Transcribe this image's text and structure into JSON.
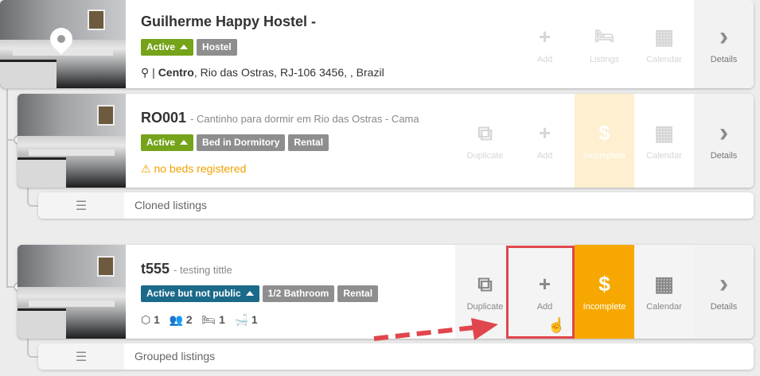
{
  "property": {
    "name": "Guilherme Happy Hostel -",
    "status": "Active",
    "type": "Hostel",
    "address_prefix": "|",
    "address_bold": "Centro",
    "address_rest": ", Rio das Ostras, RJ-106 3456, , Brazil",
    "actions": [
      {
        "label": "Add",
        "icon": "plus-icon",
        "glyph": "+"
      },
      {
        "label": "Listings",
        "icon": "bed-icon",
        "glyph": "🛏"
      },
      {
        "label": "Calendar",
        "icon": "calendar-icon",
        "glyph": "▦"
      },
      {
        "label": "Details",
        "icon": "chevron-right-icon",
        "glyph": "›"
      }
    ]
  },
  "listing1": {
    "code": "RO001",
    "subtitle": "- Cantinho para dormir em Rio das Ostras - Cama",
    "badges": [
      "Active",
      "Bed in Dormitory",
      "Rental"
    ],
    "warning": "no beds registered",
    "actions": [
      {
        "label": "Duplicate",
        "icon": "duplicate-icon",
        "glyph": "⧉"
      },
      {
        "label": "Add",
        "icon": "plus-icon",
        "glyph": "+"
      },
      {
        "label": "Incomplete",
        "icon": "dollar-icon",
        "glyph": "$"
      },
      {
        "label": "Calendar",
        "icon": "calendar-icon",
        "glyph": "▦"
      },
      {
        "label": "Details",
        "icon": "chevron-right-icon",
        "glyph": "›"
      }
    ]
  },
  "cloned": {
    "label": "Cloned listings"
  },
  "listing2": {
    "code": "t555",
    "subtitle": "- testing tittle",
    "badges": [
      "Active but not public",
      "1/2 Bathroom",
      "Rental"
    ],
    "counts": {
      "units": "1",
      "guests": "2",
      "beds": "1",
      "baths": "1"
    },
    "actions": [
      {
        "label": "Duplicate",
        "icon": "duplicate-icon",
        "glyph": "⧉"
      },
      {
        "label": "Add",
        "icon": "plus-icon",
        "glyph": "+"
      },
      {
        "label": "Incomplete",
        "icon": "dollar-icon",
        "glyph": "$"
      },
      {
        "label": "Calendar",
        "icon": "calendar-icon",
        "glyph": "▦"
      },
      {
        "label": "Details",
        "icon": "chevron-right-icon",
        "glyph": "›"
      }
    ]
  },
  "grouped": {
    "label": "Grouped listings"
  },
  "colors": {
    "active": "#75a31a",
    "not_public": "#1b6a8a",
    "incomplete": "#f7a800",
    "highlight": "#e0464d"
  }
}
